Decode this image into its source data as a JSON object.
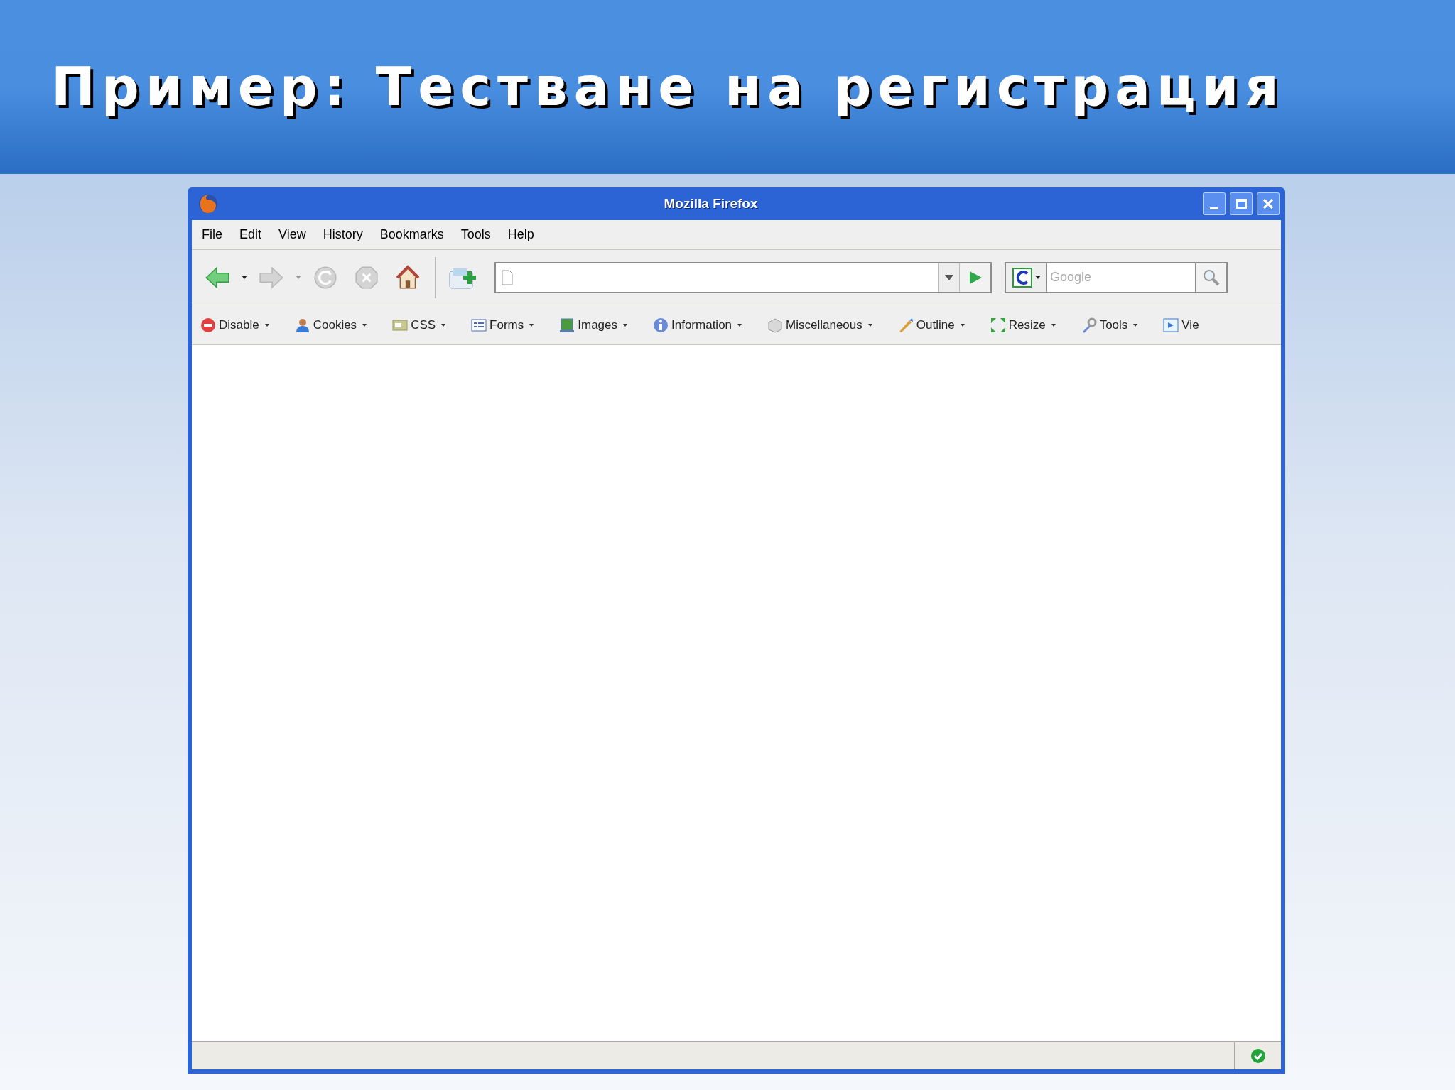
{
  "slide": {
    "title": "Пример: Тестване на регистрация"
  },
  "window": {
    "title": "Mozilla Firefox"
  },
  "menu": [
    "File",
    "Edit",
    "View",
    "History",
    "Bookmarks",
    "Tools",
    "Help"
  ],
  "nav_buttons": [
    {
      "kind": "back",
      "disabled": false
    },
    {
      "kind": "forward",
      "disabled": true
    },
    {
      "kind": "reload",
      "disabled": true
    },
    {
      "kind": "stop",
      "disabled": true
    },
    {
      "kind": "home",
      "disabled": false
    }
  ],
  "search": {
    "placeholder": "Google"
  },
  "extension_toolbar": [
    {
      "label": "Disable"
    },
    {
      "label": "Cookies"
    },
    {
      "label": "CSS"
    },
    {
      "label": "Forms"
    },
    {
      "label": "Images"
    },
    {
      "label": "Information"
    },
    {
      "label": "Miscellaneous"
    },
    {
      "label": "Outline"
    },
    {
      "label": "Resize"
    },
    {
      "label": "Tools"
    },
    {
      "label": "Vie"
    }
  ]
}
